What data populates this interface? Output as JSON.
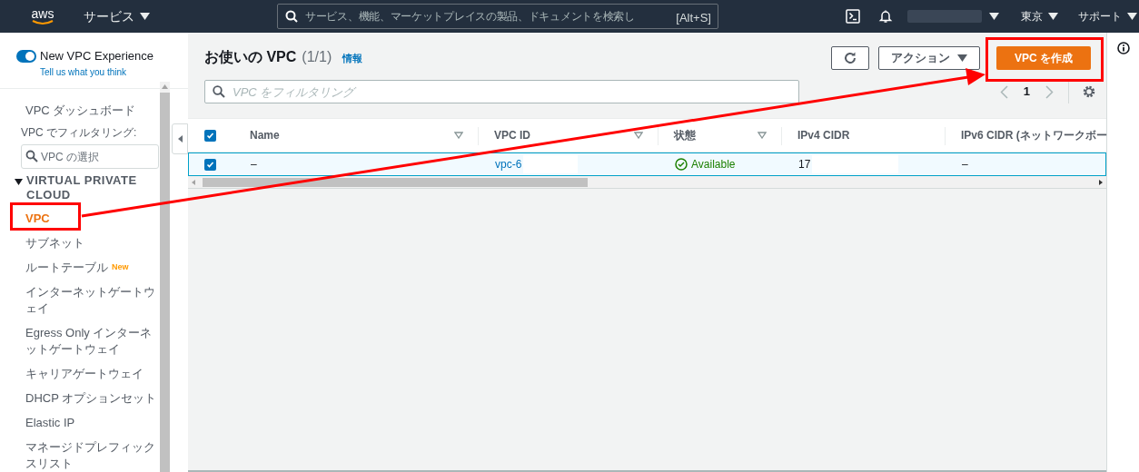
{
  "top_nav": {
    "logo": "aws",
    "services_label": "サービス",
    "search": {
      "placeholder": "サービス、機能、マーケットプレイスの製品、ドキュメントを検索し",
      "shortcut": "[Alt+S]"
    },
    "region": "東京",
    "support": "サポート"
  },
  "sidebar": {
    "toggle": {
      "label": "New VPC Experience",
      "on": true,
      "feedback_link": "Tell us what you think"
    },
    "dashboard": "VPC ダッシュボード",
    "filter_label": "VPC でフィルタリング:",
    "filter_field": {
      "placeholder": "VPC の選択"
    },
    "section": {
      "title": "VIRTUAL PRIVATE CLOUD",
      "expanded": true
    },
    "items": [
      {
        "label": "VPC",
        "selected": true
      },
      {
        "label": "サブネット",
        "selected": false
      },
      {
        "label": "ルートテーブル",
        "selected": false,
        "badge": "New"
      },
      {
        "label": "インターネットゲートウェイ",
        "selected": false
      },
      {
        "label": "Egress Only インターネットゲートウェイ",
        "selected": false
      },
      {
        "label": "キャリアゲートウェイ",
        "selected": false
      },
      {
        "label": "DHCP オプションセット",
        "selected": false
      },
      {
        "label": "Elastic IP",
        "selected": false
      },
      {
        "label": "マネージドプレフィックスリスト",
        "selected": false
      }
    ]
  },
  "main": {
    "title": "お使いの VPC",
    "count": "(1/1)",
    "info_link": "情報",
    "actions_button": "アクション",
    "create_button": "VPC を作成",
    "filter_field": {
      "placeholder": "VPC をフィルタリング"
    },
    "page": "1",
    "table": {
      "all_checked": true,
      "columns": [
        {
          "label": "Name",
          "sortable": true
        },
        {
          "label": "VPC ID",
          "sortable": true
        },
        {
          "label": "状態",
          "sortable": true
        },
        {
          "label": "IPv4 CIDR",
          "sortable": false
        },
        {
          "label": "IPv6 CIDR (ネットワークボー"
        }
      ],
      "rows": [
        {
          "selected": true,
          "name": "–",
          "vpc_id": "vpc-6",
          "state": "Available",
          "ipv4": "17",
          "ipv6": "–"
        }
      ]
    }
  }
}
